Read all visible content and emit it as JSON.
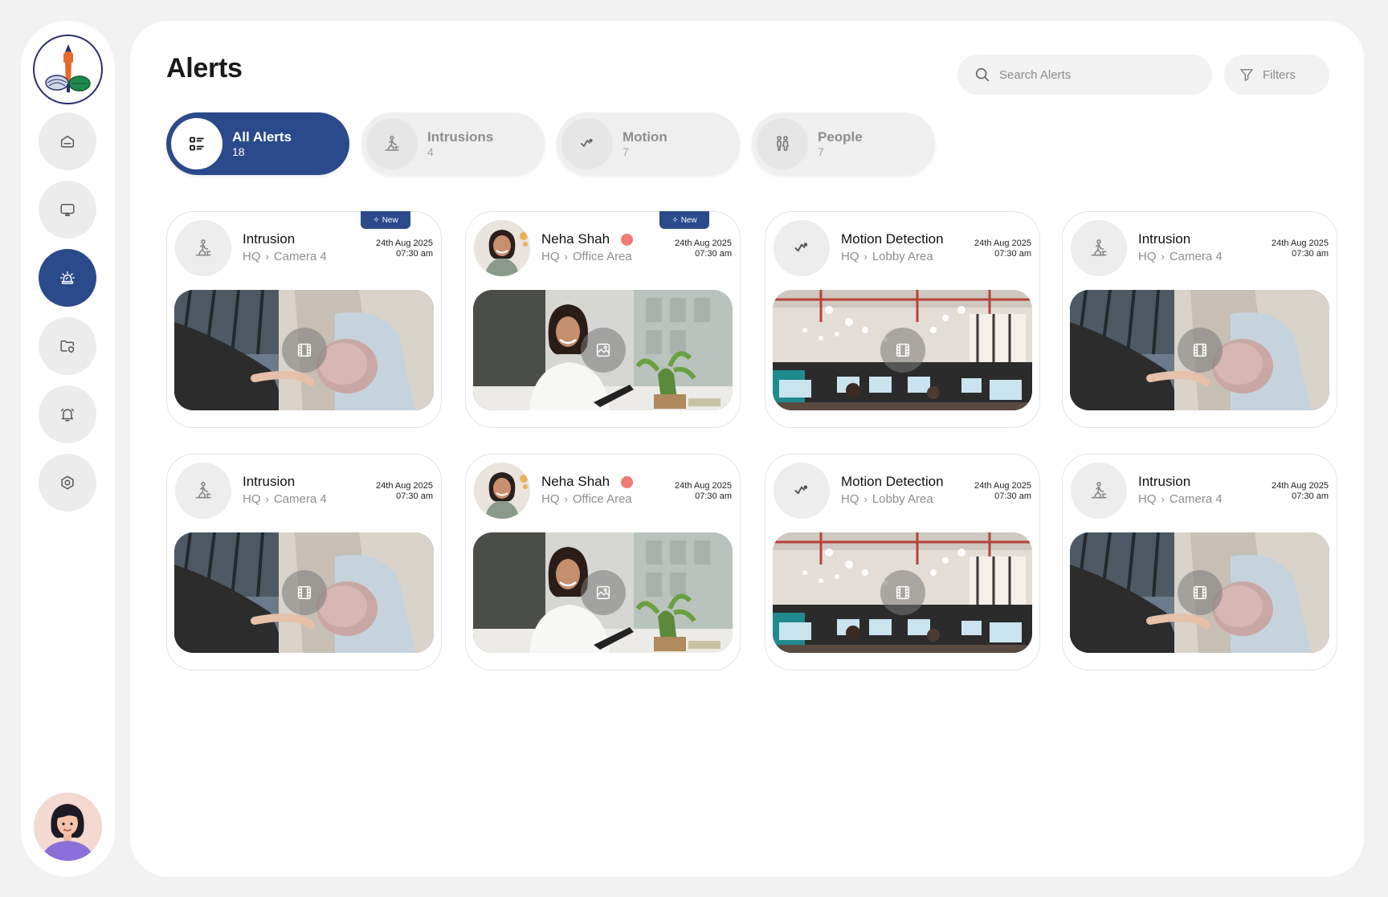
{
  "page": {
    "title": "Alerts"
  },
  "search": {
    "placeholder": "Search Alerts"
  },
  "filters": {
    "label": "Filters"
  },
  "sidebar": {
    "nav": [
      {
        "name": "home",
        "icon": "home-icon"
      },
      {
        "name": "monitor",
        "icon": "monitor-icon"
      },
      {
        "name": "alerts",
        "icon": "siren-icon",
        "active": true
      },
      {
        "name": "files",
        "icon": "folder-shield-icon"
      },
      {
        "name": "notifications",
        "icon": "bell-icon"
      },
      {
        "name": "settings",
        "icon": "settings-icon"
      }
    ]
  },
  "tabs": [
    {
      "label": "All Alerts",
      "count": "18",
      "icon": "list-icon",
      "active": true
    },
    {
      "label": "Intrusions",
      "count": "4",
      "icon": "intruder-icon"
    },
    {
      "label": "Motion",
      "count": "7",
      "icon": "motion-icon"
    },
    {
      "label": "People",
      "count": "7",
      "icon": "people-icon"
    }
  ],
  "colors": {
    "accent": "#2b4a8b",
    "status_dot": "#f27a74"
  },
  "badge": {
    "label": "New"
  },
  "cards": [
    {
      "title": "Intrusion",
      "site": "HQ",
      "location": "Camera 4",
      "date": "24th Aug 2025",
      "time": "07:30 am",
      "type": "intrusion",
      "media": "video",
      "is_new": true
    },
    {
      "title": "Neha Shah",
      "site": "HQ",
      "location": "Office Area",
      "date": "24th Aug 2025",
      "time": "07:30 am",
      "type": "person",
      "media": "image",
      "is_new": true
    },
    {
      "title": "Motion Detection",
      "site": "HQ",
      "location": "Lobby Area",
      "date": "24th Aug 2025",
      "time": "07:30 am",
      "type": "motion",
      "media": "video",
      "is_new": false
    },
    {
      "title": "Intrusion",
      "site": "HQ",
      "location": "Camera 4",
      "date": "24th Aug 2025",
      "time": "07:30 am",
      "type": "intrusion",
      "media": "video",
      "is_new": false
    },
    {
      "title": "Intrusion",
      "site": "HQ",
      "location": "Camera 4",
      "date": "24th Aug 2025",
      "time": "07:30 am",
      "type": "intrusion",
      "media": "video",
      "is_new": false
    },
    {
      "title": "Neha Shah",
      "site": "HQ",
      "location": "Office Area",
      "date": "24th Aug 2025",
      "time": "07:30 am",
      "type": "person",
      "media": "image",
      "is_new": false
    },
    {
      "title": "Motion Detection",
      "site": "HQ",
      "location": "Lobby Area",
      "date": "24th Aug 2025",
      "time": "07:30 am",
      "type": "motion",
      "media": "video",
      "is_new": false
    },
    {
      "title": "Intrusion",
      "site": "HQ",
      "location": "Camera 4",
      "date": "24th Aug 2025",
      "time": "07:30 am",
      "type": "intrusion",
      "media": "video",
      "is_new": false
    }
  ]
}
